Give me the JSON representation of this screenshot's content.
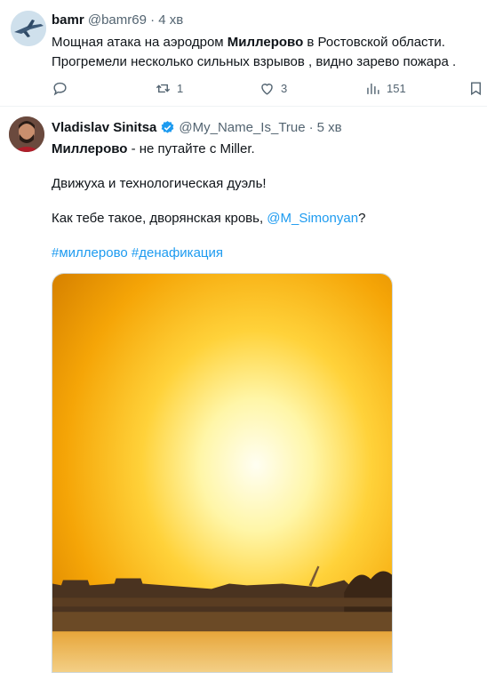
{
  "tweet1": {
    "author_name": "bamr",
    "author_handle": "@bamr69",
    "separator": "·",
    "time": "4 хв",
    "text_a": "Мощная атака  на аэродром ",
    "text_bold": "Миллерово",
    "text_b": " в Ростовской области.",
    "text_line2": "Прогремели несколько сильных взрывов , видно зарево пожара .",
    "replies_icon": "reply-icon",
    "reposts_icon": "repost-icon",
    "reposts": "1",
    "likes_icon": "heart-icon",
    "likes": "3",
    "views_icon": "views-icon",
    "views": "151",
    "bookmark_icon": "bookmark-icon"
  },
  "tweet2": {
    "author_name": "Vladislav Sinitsa",
    "verified_icon": "verified-badge-icon",
    "author_handle": "@My_Name_Is_True",
    "separator": "·",
    "time": "5 хв",
    "line1_bold": "Миллерово",
    "line1_rest": " - не путайте с Miller.",
    "line2": "Движуха и технологическая дуэль!",
    "line3_a": "Как тебе такое, дворянская кровь, ",
    "line3_mention": "@M_Simonyan",
    "line3_b": "?",
    "hashtag1": "#миллерово",
    "hashtag2": "#денафикация",
    "media_alt": "fire-glow-photo"
  },
  "colors": {
    "text": "#0f1419",
    "muted": "#536471",
    "link": "#1d9bf0",
    "verified": "#1d9bf0"
  }
}
